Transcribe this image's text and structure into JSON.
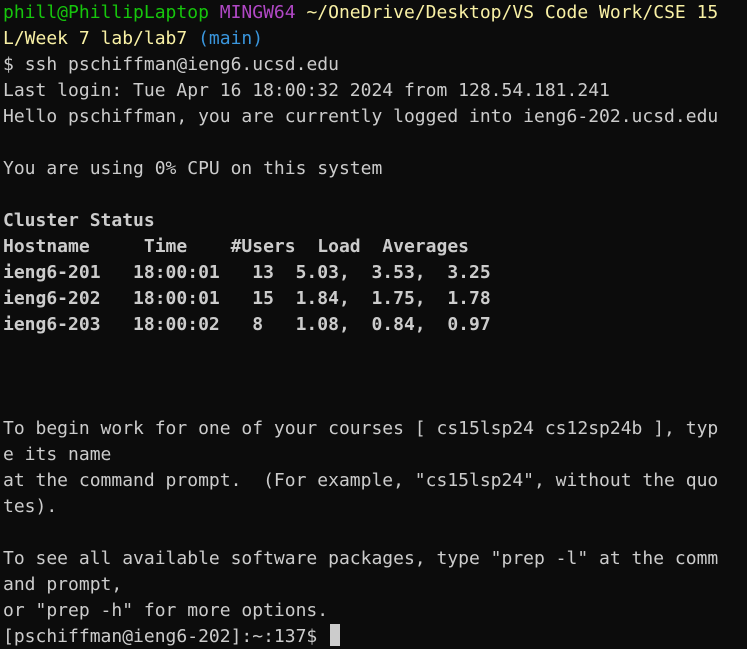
{
  "terminal": {
    "prompt": {
      "user_host": "phill@PhillipLaptop",
      "env": "MINGW64",
      "path_line1": "~/OneDrive/Desktop/VS Code Work/CSE 15",
      "path_line2": "L/Week 7 lab/lab7",
      "branch": "(main)"
    },
    "command_prompt": "$ ",
    "command": "ssh pschiffman@ieng6.ucsd.edu",
    "last_login": "Last login: Tue Apr 16 18:00:32 2024 from 128.54.181.241",
    "hello": "Hello pschiffman, you are currently logged into ieng6-202.ucsd.edu",
    "cpu": "You are using 0% CPU on this system",
    "cluster_title": "Cluster Status",
    "cluster_header": "Hostname     Time    #Users  Load  Averages",
    "cluster_rows": [
      "ieng6-201   18:00:01   13  5.03,  3.53,  3.25",
      "ieng6-202   18:00:01   15  1.84,  1.75,  1.78",
      "ieng6-203   18:00:02   8   1.08,  0.84,  0.97"
    ],
    "courses_line1": "To begin work for one of your courses [ cs15lsp24 cs12sp24b ], typ",
    "courses_line2": "e its name",
    "courses_line3": "at the command prompt.  (For example, \"cs15lsp24\", without the quo",
    "courses_line4": "tes).",
    "prep_line1": "To see all available software packages, type \"prep -l\" at the comm",
    "prep_line2": "and prompt,",
    "prep_line3": "or \"prep -h\" for more options.",
    "final_prompt": "[pschiffman@ieng6-202]:~:137$ "
  },
  "colors": {
    "background": "#0c0c0c",
    "text": "#cccccc",
    "user_host": "#16c60c",
    "env": "#b148c6",
    "path": "#f9f1a5",
    "branch": "#3a96dd"
  }
}
